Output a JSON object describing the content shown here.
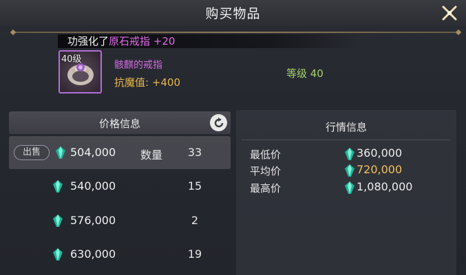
{
  "window": {
    "title": "购买物品"
  },
  "banner": {
    "prefix": "功强化了",
    "item": "原石戒指 +20"
  },
  "item": {
    "level": "40级",
    "name": "骸麒的戒指",
    "stat": "抗魔值: +400",
    "level_requirement": "等级 40",
    "rarity_color": "#b46fd6"
  },
  "price_panel": {
    "title": "价格信息",
    "sell_label": "出售",
    "qty_label": "数量",
    "rows": [
      {
        "price": "504,000",
        "qty": "33"
      },
      {
        "price": "540,000",
        "qty": "15"
      },
      {
        "price": "576,000",
        "qty": "2"
      },
      {
        "price": "630,000",
        "qty": "19"
      }
    ]
  },
  "market_panel": {
    "title": "行情信息",
    "rows": [
      {
        "label": "最低价",
        "value": "360,000"
      },
      {
        "label": "平均价",
        "value": "720,000"
      },
      {
        "label": "最高价",
        "value": "1,080,000"
      }
    ]
  },
  "icons": {
    "close": "close-icon",
    "refresh": "refresh-icon",
    "currency": "green-gem-icon"
  }
}
